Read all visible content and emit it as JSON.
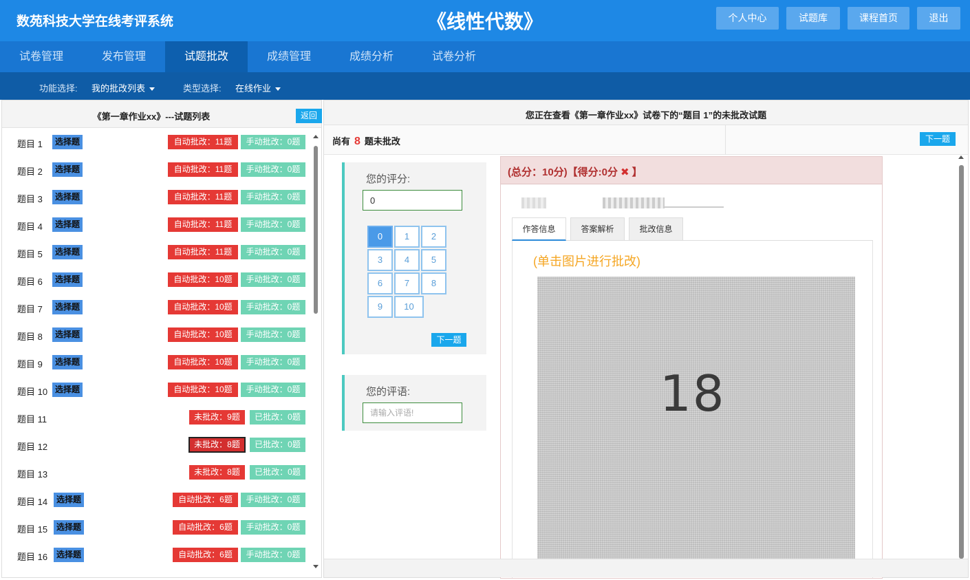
{
  "header": {
    "brand": "数苑科技大学在线考评系统",
    "course": "《线性代数》",
    "buttons": [
      "个人中心",
      "试题库",
      "课程首页",
      "退出"
    ]
  },
  "nav": {
    "items": [
      "试卷管理",
      "发布管理",
      "试题批改",
      "成绩管理",
      "成绩分析",
      "试卷分析"
    ],
    "active": "试题批改"
  },
  "subnav": {
    "func_label": "功能选择:",
    "func_value": "我的批改列表",
    "type_label": "类型选择:",
    "type_value": "在线作业"
  },
  "left": {
    "title": "《第一章作业xx》---试题列表",
    "back": "返回",
    "questions": [
      {
        "label": "题目 1",
        "type": "选择题",
        "b1": "自动批改：11题",
        "b2": "手动批改：0题"
      },
      {
        "label": "题目 2",
        "type": "选择题",
        "b1": "自动批改：11题",
        "b2": "手动批改：0题"
      },
      {
        "label": "题目 3",
        "type": "选择题",
        "b1": "自动批改：11题",
        "b2": "手动批改：0题"
      },
      {
        "label": "题目 4",
        "type": "选择题",
        "b1": "自动批改：11题",
        "b2": "手动批改：0题"
      },
      {
        "label": "题目 5",
        "type": "选择题",
        "b1": "自动批改：11题",
        "b2": "手动批改：0题"
      },
      {
        "label": "题目 6",
        "type": "选择题",
        "b1": "自动批改：10题",
        "b2": "手动批改：0题"
      },
      {
        "label": "题目 7",
        "type": "选择题",
        "b1": "自动批改：10题",
        "b2": "手动批改：0题"
      },
      {
        "label": "题目 8",
        "type": "选择题",
        "b1": "自动批改：10题",
        "b2": "手动批改：0题"
      },
      {
        "label": "题目 9",
        "type": "选择题",
        "b1": "自动批改：10题",
        "b2": "手动批改：0题"
      },
      {
        "label": "题目 10",
        "type": "选择题",
        "b1": "自动批改：10题",
        "b2": "手动批改：0题"
      },
      {
        "label": "题目 11",
        "type": "",
        "b1": "未批改：9题",
        "b2": "已批改：0题"
      },
      {
        "label": "题目 12",
        "type": "",
        "b1": "未批改：8题",
        "b2": "已批改：0题"
      },
      {
        "label": "题目 13",
        "type": "",
        "b1": "未批改：8题",
        "b2": "已批改：0题"
      },
      {
        "label": "题目 14",
        "type": "选择题",
        "b1": "自动批改：6题",
        "b2": "手动批改：0题"
      },
      {
        "label": "题目 15",
        "type": "选择题",
        "b1": "自动批改：6题",
        "b2": "手动批改：0题"
      },
      {
        "label": "题目 16",
        "type": "选择题",
        "b1": "自动批改：6题",
        "b2": "手动批改：0题"
      }
    ]
  },
  "right": {
    "title": "您正在查看《第一章作业xx》试卷下的“题目 1”的未批改试题",
    "remain_prefix": "尚有",
    "remain_count": "8",
    "remain_suffix": "题未批改",
    "next_top": "下一题",
    "score_label": "您的评分:",
    "score_value": "0",
    "score_options": [
      "0",
      "1",
      "2",
      "3",
      "4",
      "5",
      "6",
      "7",
      "8",
      "9",
      "10"
    ],
    "score_selected": "0",
    "next_btn": "下一题",
    "comment_label": "您的评语:",
    "comment_placeholder": "请输入评语!",
    "answer_title_a": "(总分：10分)【得分:0分",
    "answer_title_b": "】",
    "tabs": [
      "作答信息",
      "答案解析",
      "批改信息"
    ],
    "hint": "(单击图片进行批改)",
    "photo_text": "18"
  }
}
